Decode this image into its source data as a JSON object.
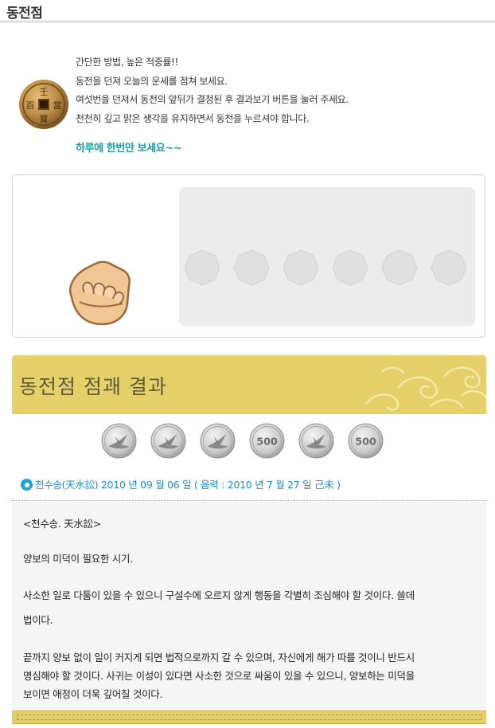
{
  "page": {
    "title": "동전점"
  },
  "intro": {
    "lines": [
      "간단한 방법, 높은 적중률!!",
      "동전을 던져 오늘의 운세를 점쳐 보세요.",
      "여섯번을 던져서 동전의 앞뒤가 결정된 후 결과보기 버튼을 눌러 주세요.",
      "천천히 깊고 맑은 생각을 유지하면서 동전을 누르셔야 합니다."
    ],
    "once_note": "하루에 한번만 보세요~~"
  },
  "result": {
    "header_title": "동전점 점괘 결과",
    "coins": [
      {
        "face": "crane",
        "label": ""
      },
      {
        "face": "crane",
        "label": ""
      },
      {
        "face": "crane",
        "label": ""
      },
      {
        "face": "500",
        "label": "500"
      },
      {
        "face": "crane",
        "label": ""
      },
      {
        "face": "500",
        "label": "500"
      }
    ],
    "summary_line": "천수송(天水訟) 2010 년 09 월 06 일 ( 음력 : 2010 년 7 월 27 일 己未 )",
    "body": {
      "heading": "<천수송. 天水訟>",
      "p1": "양보의 미덕이 필요한 시기.",
      "p2_line1": "사소한 일로 다툼이 있을 수 있으니 구설수에 오르지 않게 행동을 각별히 조심해야 할 것이다. 쓸데",
      "p2_line2": "법이다.",
      "p3_line1": "끝까지 양보 없이 일이 커지게 되면 법적으로까지 갈 수 있으며, 자신에게 해가 따를 것이니 반드시",
      "p3_line2": "명심해야 할 것이다. 사귀는 이성이 있다면 사소한 것으로 싸움이 있을 수 있으니, 양보하는 미덕을",
      "p3_line3": "보이면 애정이 더욱 깊어질 것이다."
    }
  },
  "colors": {
    "accent_teal": "#1a9fa0",
    "result_blue": "#1c90c8",
    "header_gold": "#e6d06a",
    "slot_gray": "#e0e0e0"
  },
  "icons": {
    "logo": "ancient-coin-icon",
    "hand": "fist-hand-icon",
    "result_dot": "bullet-circle-icon"
  }
}
